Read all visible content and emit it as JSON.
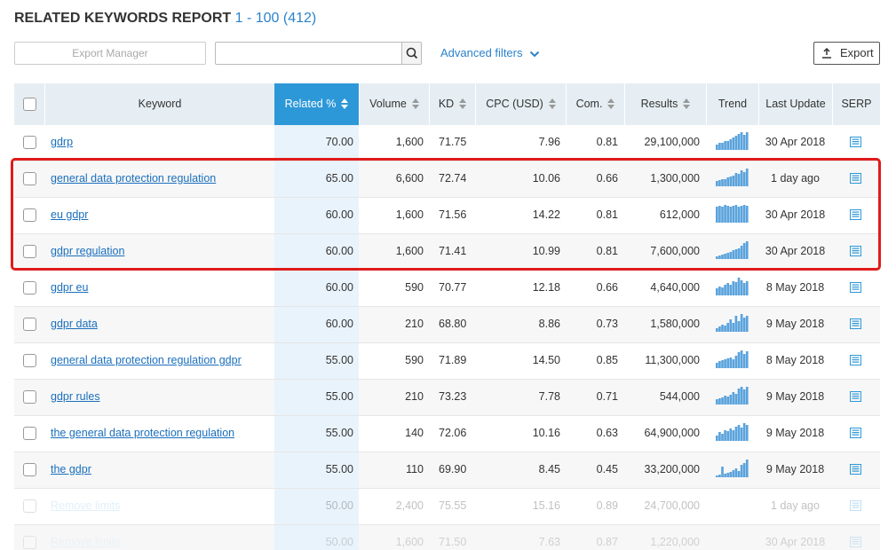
{
  "header": {
    "title": "RELATED KEYWORDS REPORT",
    "range": "1 - 100 (412)"
  },
  "toolbar": {
    "export_manager": "Export Manager",
    "search_value": "",
    "advanced_filters": "Advanced filters",
    "export_label": "Export"
  },
  "columns": {
    "keyword": "Keyword",
    "related": "Related %",
    "volume": "Volume",
    "kd": "KD",
    "cpc": "CPC (USD)",
    "com": "Com.",
    "results": "Results",
    "trend": "Trend",
    "last_update": "Last Update",
    "serp": "SERP"
  },
  "rows": [
    {
      "keyword": "gdrp",
      "related": "70.00",
      "volume": "1,600",
      "kd": "71.75",
      "cpc": "7.96",
      "com": "0.81",
      "results": "29,100,000",
      "last_update": "30 Apr 2018",
      "trend": [
        0.3,
        0.4,
        0.4,
        0.5,
        0.5,
        0.6,
        0.7,
        0.8,
        0.9,
        1.0,
        0.85,
        1.0
      ]
    },
    {
      "keyword": "general data protection regulation",
      "related": "65.00",
      "volume": "6,600",
      "kd": "72.74",
      "cpc": "10.06",
      "com": "0.66",
      "results": "1,300,000",
      "last_update": "1 day ago",
      "trend": [
        0.3,
        0.35,
        0.4,
        0.4,
        0.5,
        0.55,
        0.6,
        0.75,
        0.7,
        0.9,
        0.8,
        1.0
      ]
    },
    {
      "keyword": "eu gdpr",
      "related": "60.00",
      "volume": "1,600",
      "kd": "71.56",
      "cpc": "14.22",
      "com": "0.81",
      "results": "612,000",
      "last_update": "30 Apr 2018",
      "trend": [
        0.9,
        0.95,
        0.9,
        1.0,
        0.95,
        0.9,
        0.95,
        1.0,
        0.9,
        0.95,
        1.0,
        0.95
      ]
    },
    {
      "keyword": "gdpr regulation",
      "related": "60.00",
      "volume": "1,600",
      "kd": "71.41",
      "cpc": "10.99",
      "com": "0.81",
      "results": "7,600,000",
      "last_update": "30 Apr 2018",
      "trend": [
        0.15,
        0.2,
        0.25,
        0.3,
        0.35,
        0.4,
        0.5,
        0.55,
        0.6,
        0.75,
        0.9,
        1.0
      ]
    },
    {
      "keyword": "gdpr eu",
      "related": "60.00",
      "volume": "590",
      "kd": "70.77",
      "cpc": "12.18",
      "com": "0.66",
      "results": "4,640,000",
      "last_update": "8 May 2018",
      "trend": [
        0.4,
        0.5,
        0.45,
        0.6,
        0.7,
        0.6,
        0.8,
        0.75,
        1.0,
        0.85,
        0.7,
        0.8
      ]
    },
    {
      "keyword": "gdpr data",
      "related": "60.00",
      "volume": "210",
      "kd": "68.80",
      "cpc": "8.86",
      "com": "0.73",
      "results": "1,580,000",
      "last_update": "9 May 2018",
      "trend": [
        0.2,
        0.3,
        0.4,
        0.35,
        0.5,
        0.7,
        0.5,
        0.9,
        0.6,
        1.0,
        0.8,
        0.9
      ]
    },
    {
      "keyword": "general data protection regulation gdpr",
      "related": "55.00",
      "volume": "590",
      "kd": "71.89",
      "cpc": "14.50",
      "com": "0.85",
      "results": "11,300,000",
      "last_update": "8 May 2018",
      "trend": [
        0.3,
        0.4,
        0.45,
        0.5,
        0.55,
        0.6,
        0.5,
        0.7,
        0.9,
        1.0,
        0.8,
        0.95
      ]
    },
    {
      "keyword": "gdpr rules",
      "related": "55.00",
      "volume": "210",
      "kd": "73.23",
      "cpc": "7.78",
      "com": "0.71",
      "results": "544,000",
      "last_update": "9 May 2018",
      "trend": [
        0.3,
        0.35,
        0.4,
        0.5,
        0.45,
        0.55,
        0.7,
        0.6,
        0.9,
        1.0,
        0.85,
        1.0
      ]
    },
    {
      "keyword": "the general data protection regulation",
      "related": "55.00",
      "volume": "140",
      "kd": "72.06",
      "cpc": "10.16",
      "com": "0.63",
      "results": "64,900,000",
      "last_update": "9 May 2018",
      "trend": [
        0.3,
        0.5,
        0.4,
        0.6,
        0.55,
        0.7,
        0.6,
        0.8,
        0.9,
        0.75,
        1.0,
        0.9
      ]
    },
    {
      "keyword": "the gdpr",
      "related": "55.00",
      "volume": "110",
      "kd": "69.90",
      "cpc": "8.45",
      "com": "0.45",
      "results": "33,200,000",
      "last_update": "9 May 2018",
      "trend": [
        0.1,
        0.15,
        0.6,
        0.2,
        0.25,
        0.3,
        0.4,
        0.5,
        0.35,
        0.7,
        0.8,
        1.0
      ]
    },
    {
      "keyword": "Remove limits",
      "related": "50.00",
      "volume": "2,400",
      "kd": "75.55",
      "cpc": "15.16",
      "com": "0.89",
      "results": "24,700,000",
      "last_update": "1 day ago",
      "trend": []
    },
    {
      "keyword": "Remove limits",
      "related": "50.00",
      "volume": "1,600",
      "kd": "71.50",
      "cpc": "7.63",
      "com": "0.87",
      "results": "1,220,000",
      "last_update": "30 Apr 2018",
      "trend": []
    }
  ],
  "colors": {
    "accent": "#2d98d8",
    "link": "#1a6fbd",
    "highlight": "#e01b1b",
    "trend_bar": "#5ba3dc"
  }
}
